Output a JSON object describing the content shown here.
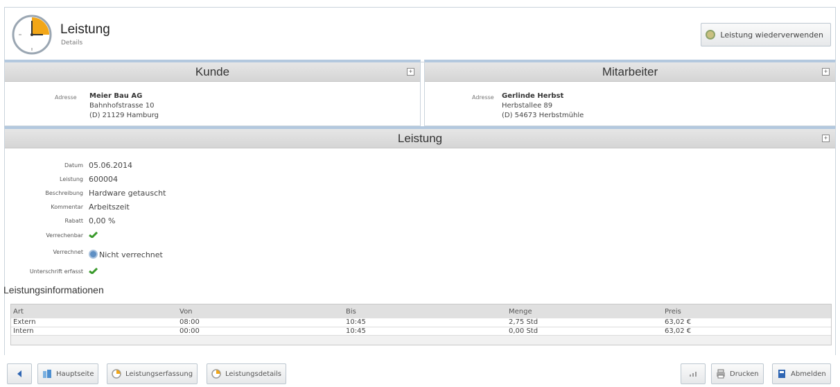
{
  "header": {
    "title": "Leistung",
    "subtitle": "Details",
    "reuse_button": "Leistung wiederverwenden"
  },
  "customer": {
    "heading": "Kunde",
    "address_label": "Adresse",
    "name": "Meier Bau AG",
    "street": "Bahnhofstrasse 10",
    "city": "(D) 21129 Hamburg"
  },
  "employee": {
    "heading": "Mitarbeiter",
    "address_label": "Adresse",
    "name": "Gerlinde Herbst",
    "street": "Herbstallee 89",
    "city": "(D) 54673 Herbstmühle"
  },
  "service": {
    "heading": "Leistung",
    "fields": [
      {
        "label": "Datum",
        "value": "05.06.2014"
      },
      {
        "label": "Leistung",
        "value": "600004"
      },
      {
        "label": "Beschreibung",
        "value": "Hardware getauscht"
      },
      {
        "label": "Kommentar",
        "value": "Arbeitszeit"
      },
      {
        "label": "Rabatt",
        "value": "0,00 %"
      },
      {
        "label": "Verrechenbar",
        "value": ""
      },
      {
        "label": "Verrechnet",
        "value": "Nicht verrechnet"
      },
      {
        "label": "Unterschrift erfasst",
        "value": ""
      }
    ]
  },
  "info": {
    "title": "Leistungsinformationen",
    "columns": [
      "Art",
      "Von",
      "Bis",
      "Menge",
      "Preis"
    ],
    "rows": [
      [
        "Extern",
        "08:00",
        "10:45",
        "2,75 Std",
        "63,02 €"
      ],
      [
        "Intern",
        "00:00",
        "10:45",
        "0,00 Std",
        "63,02 €"
      ]
    ]
  },
  "footer": {
    "home": "Hauptseite",
    "capture": "Leistungserfassung",
    "details": "Leistungsdetails",
    "print": "Drucken",
    "logout": "Abmelden"
  },
  "colors": {
    "panel_accent": "#b3c8de",
    "check_green": "#3a9a2c",
    "logout_blue": "#2f66b3"
  }
}
